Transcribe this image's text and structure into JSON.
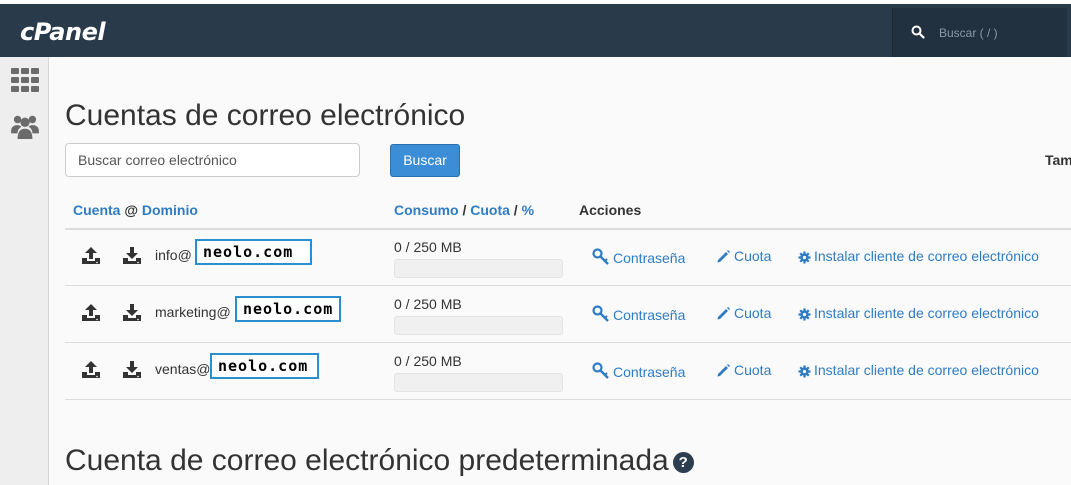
{
  "header": {
    "logo": "cPanel",
    "search_placeholder": "Buscar ( / )"
  },
  "sidebar": {
    "items": [
      {
        "icon": "grid-icon"
      },
      {
        "icon": "users-icon"
      }
    ]
  },
  "page": {
    "title": "Cuentas de correo electrónico",
    "search": {
      "placeholder": "Buscar correo electrónico",
      "button": "Buscar"
    },
    "truncated_label": "Tam"
  },
  "table": {
    "headers": {
      "cuenta": "Cuenta",
      "at": "@",
      "dominio": "Dominio",
      "consumo": "Consumo",
      "slash1": "/",
      "cuota": "Cuota",
      "slash2": "/",
      "percent": "%",
      "acciones": "Acciones"
    },
    "rows": [
      {
        "user": "info@",
        "domain": "neolo.com",
        "usage": "0 / 250 MB",
        "usage_fraction": 0.0
      },
      {
        "user": "marketing@",
        "domain": "neolo.com",
        "usage": "0 / 250 MB",
        "usage_fraction": 0.0
      },
      {
        "user": "ventas@",
        "domain": "neolo.com",
        "usage": "0 / 250 MB",
        "usage_fraction": 0.0
      }
    ],
    "actions": {
      "password": "Contraseña",
      "quota": "Cuota",
      "install": "Instalar cliente de correo electrónico"
    }
  },
  "section2": {
    "title": "Cuenta de correo electrónico predeterminada",
    "help": "?"
  },
  "colors": {
    "topbar": "#293a4a",
    "accent": "#3b8dd6",
    "link": "#2f7cc4",
    "domain_box_border": "#2a8fd0"
  }
}
